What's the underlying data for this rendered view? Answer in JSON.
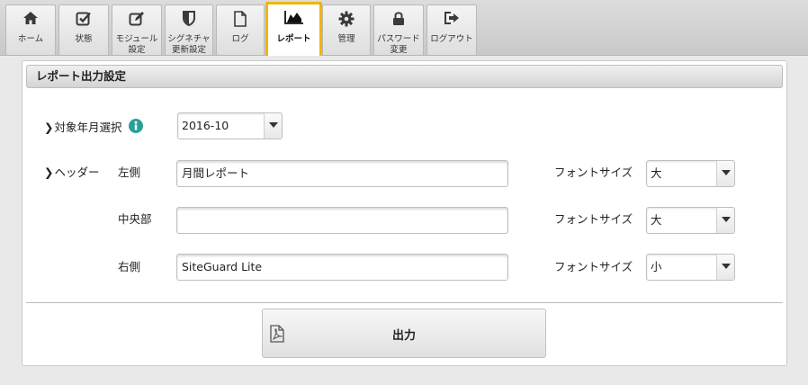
{
  "nav": {
    "items": [
      {
        "label": "ホーム",
        "icon": "home-icon"
      },
      {
        "label": "状態",
        "icon": "checkbox-icon"
      },
      {
        "label": "モジュール\n設定",
        "icon": "edit-icon"
      },
      {
        "label": "シグネチャ\n更新設定",
        "icon": "shield-icon"
      },
      {
        "label": "ログ",
        "icon": "document-icon"
      },
      {
        "label": "レポート",
        "icon": "area-chart-icon",
        "active": true
      },
      {
        "label": "管理",
        "icon": "gear-icon"
      },
      {
        "label": "パスワード\n変更",
        "icon": "lock-icon"
      },
      {
        "label": "ログアウト",
        "icon": "logout-icon"
      }
    ],
    "active_color": "#f2b500"
  },
  "panel": {
    "title": "レポート出力設定",
    "target_month": {
      "label": "対象年月選択",
      "value": "2016-10"
    },
    "header": {
      "label": "ヘッダー",
      "rows": [
        {
          "position_label": "左側",
          "value": "月間レポート",
          "font_size_label": "フォントサイズ",
          "font_size": "大"
        },
        {
          "position_label": "中央部",
          "value": "",
          "font_size_label": "フォントサイズ",
          "font_size": "大"
        },
        {
          "position_label": "右側",
          "value": "SiteGuard Lite",
          "font_size_label": "フォントサイズ",
          "font_size": "小"
        }
      ]
    },
    "export_button": {
      "label": "出力",
      "icon": "pdf-icon"
    }
  },
  "colors": {
    "info": "#2aa198",
    "highlight": "#f2b500"
  }
}
